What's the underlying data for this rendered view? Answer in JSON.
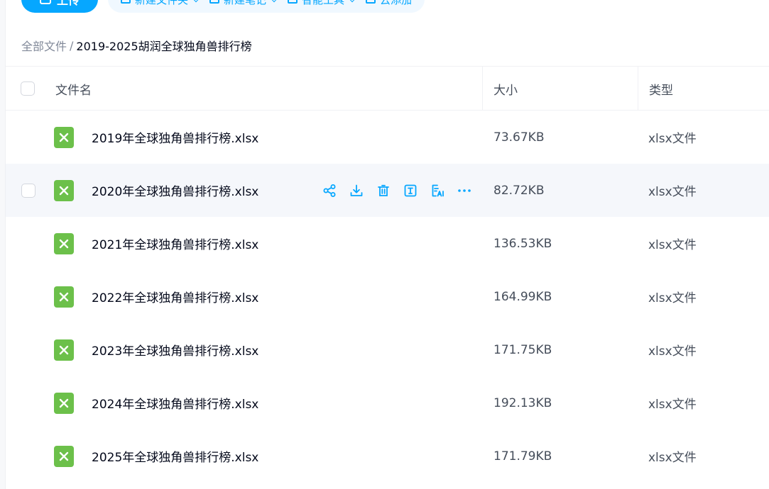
{
  "toolbar": {
    "upload_label": "上传",
    "items": [
      "新建文件夹",
      "新建笔记",
      "智能工具",
      "云添加"
    ]
  },
  "breadcrumb": {
    "root": "全部文件",
    "separator": "/",
    "current": "2019-2025胡润全球独角兽排行榜"
  },
  "table": {
    "headers": {
      "name": "文件名",
      "size": "大小",
      "type": "类型"
    },
    "rows": [
      {
        "name": "2019年全球独角兽排行榜.xlsx",
        "size": "73.67KB",
        "type": "xlsx文件"
      },
      {
        "name": "2020年全球独角兽排行榜.xlsx",
        "size": "82.72KB",
        "type": "xlsx文件"
      },
      {
        "name": "2021年全球独角兽排行榜.xlsx",
        "size": "136.53KB",
        "type": "xlsx文件"
      },
      {
        "name": "2022年全球独角兽排行榜.xlsx",
        "size": "164.99KB",
        "type": "xlsx文件"
      },
      {
        "name": "2023年全球独角兽排行榜.xlsx",
        "size": "171.75KB",
        "type": "xlsx文件"
      },
      {
        "name": "2024年全球独角兽排行榜.xlsx",
        "size": "192.13KB",
        "type": "xlsx文件"
      },
      {
        "name": "2025年全球独角兽排行榜.xlsx",
        "size": "171.79KB",
        "type": "xlsx文件"
      }
    ],
    "hover_actions": [
      "share-icon",
      "download-icon",
      "delete-icon",
      "rename-icon",
      "ai-doc-icon",
      "more-icon"
    ]
  },
  "colors": {
    "accent": "#06a7ff",
    "xlsx_icon": "#6cc04a",
    "hover_row": "#f5f7fb",
    "text_primary": "#03081a",
    "text_secondary": "#454d5a",
    "text_muted": "#818999"
  }
}
